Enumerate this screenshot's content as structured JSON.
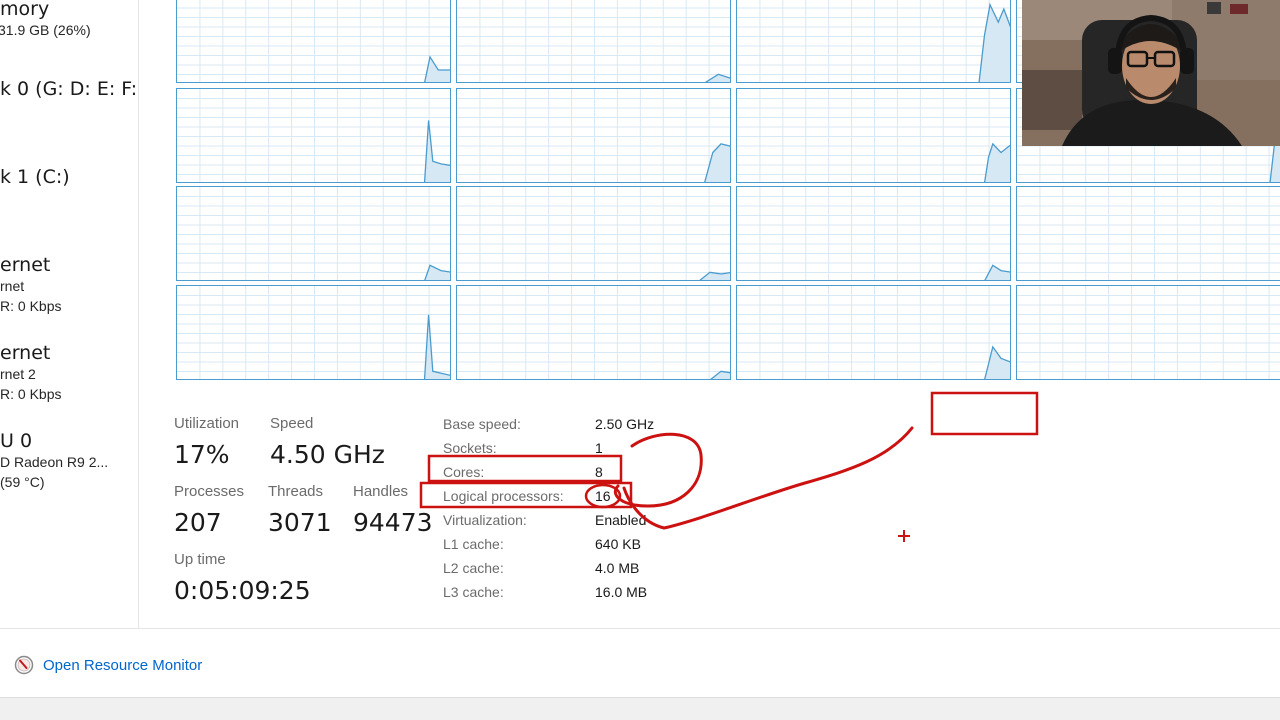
{
  "sidebar": {
    "items": [
      {
        "title": "mory",
        "sub1": "31.9 GB (26%)",
        "sub2": ""
      },
      {
        "title": "k 0 (G: D: E: F:)",
        "sub1": "",
        "sub2": ""
      },
      {
        "title": "k 1 (C:)",
        "sub1": "",
        "sub2": ""
      },
      {
        "title": "ernet",
        "sub1": "rnet",
        "sub2": "R: 0 Kbps"
      },
      {
        "title": "ernet",
        "sub1": "rnet 2",
        "sub2": "R: 0 Kbps"
      },
      {
        "title": "U 0",
        "sub1": "D Radeon R9 2...",
        "sub2": "(59 °C)"
      }
    ]
  },
  "graphs": {
    "count": 16,
    "line_color": "#4a9ccf",
    "fill_color": "#d5e8f4",
    "grid_color": "#d9e9f3"
  },
  "stats": {
    "utilization": {
      "label": "Utilization",
      "value": "17%"
    },
    "speed": {
      "label": "Speed",
      "value": "4.50 GHz"
    },
    "processes": {
      "label": "Processes",
      "value": "207"
    },
    "threads": {
      "label": "Threads",
      "value": "3071"
    },
    "handles": {
      "label": "Handles",
      "value": "94473"
    },
    "uptime": {
      "label": "Up time",
      "value": "0:05:09:25"
    }
  },
  "details": [
    {
      "label": "Base speed:",
      "value": "2.50 GHz"
    },
    {
      "label": "Sockets:",
      "value": "1"
    },
    {
      "label": "Cores:",
      "value": "8"
    },
    {
      "label": "Logical processors:",
      "value": "16"
    },
    {
      "label": "Virtualization:",
      "value": "Enabled"
    },
    {
      "label": "L1 cache:",
      "value": "640 KB"
    },
    {
      "label": "L2 cache:",
      "value": "4.0 MB"
    },
    {
      "label": "L3 cache:",
      "value": "16.0 MB"
    }
  ],
  "footer": {
    "resource_monitor_label": "Open Resource Monitor"
  },
  "annotation": {
    "color": "#cc1111"
  }
}
